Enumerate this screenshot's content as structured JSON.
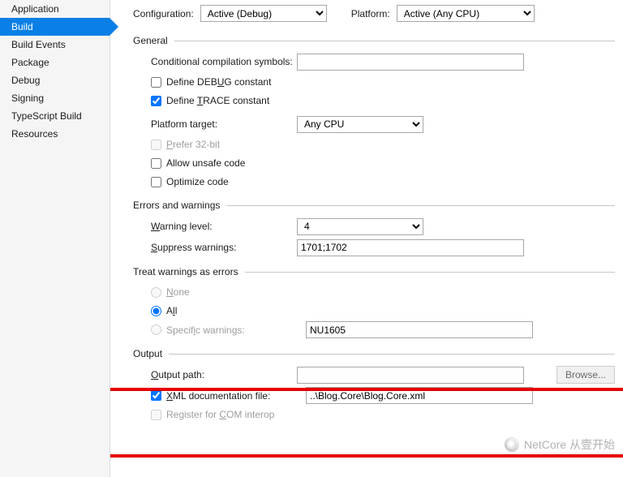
{
  "sidebar": {
    "items": [
      {
        "label": "Application"
      },
      {
        "label": "Build"
      },
      {
        "label": "Build Events"
      },
      {
        "label": "Package"
      },
      {
        "label": "Debug"
      },
      {
        "label": "Signing"
      },
      {
        "label": "TypeScript Build"
      },
      {
        "label": "Resources"
      }
    ],
    "active_index": 1
  },
  "top": {
    "configuration_label": "Configuration:",
    "configuration_value": "Active (Debug)",
    "platform_label": "Platform:",
    "platform_value": "Active (Any CPU)"
  },
  "groups": {
    "general": {
      "title": "General",
      "conditional_label": "Conditional compilation symbols:",
      "conditional_value": "",
      "define_debug_label": "Define DEBUG constant",
      "define_debug_checked": false,
      "define_trace_label": "Define TRACE constant",
      "define_trace_checked": true,
      "platform_target_label": "Platform target:",
      "platform_target_value": "Any CPU",
      "prefer32_label": "Prefer 32-bit",
      "prefer32_checked": false,
      "prefer32_disabled": true,
      "allow_unsafe_label": "Allow unsafe code",
      "allow_unsafe_checked": false,
      "optimize_label": "Optimize code",
      "optimize_checked": false
    },
    "errors": {
      "title": "Errors and warnings",
      "warning_level_label": "Warning level:",
      "warning_level_value": "4",
      "suppress_label": "Suppress warnings:",
      "suppress_value": "1701;1702"
    },
    "treat": {
      "title": "Treat warnings as errors",
      "none_label": "None",
      "all_label": "All",
      "specific_label": "Specific warnings:",
      "specific_value": "NU1605",
      "selected": "all"
    },
    "output": {
      "title": "Output",
      "output_path_label": "Output path:",
      "output_path_value": "",
      "browse_label": "Browse...",
      "xml_doc_label": "XML documentation file:",
      "xml_doc_checked": true,
      "xml_doc_value": "..\\Blog.Core\\Blog.Core.xml",
      "register_com_label": "Register for COM interop",
      "register_com_checked": false,
      "register_com_disabled": true
    }
  },
  "watermark": {
    "text": "NetCore 从壹开始"
  }
}
